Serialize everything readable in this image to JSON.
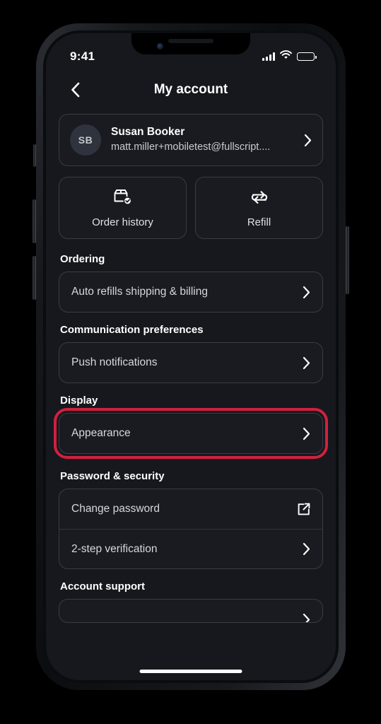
{
  "status_bar": {
    "time": "9:41",
    "signal_icon": "cellular-bars-icon",
    "wifi_icon": "wifi-icon",
    "battery_icon": "battery-full-icon"
  },
  "nav": {
    "back_icon": "chevron-left-icon",
    "title": "My account"
  },
  "profile": {
    "initials": "SB",
    "name": "Susan Booker",
    "email": "matt.miller+mobiletest@fullscript....",
    "chevron_icon": "chevron-right-icon"
  },
  "quick_actions": [
    {
      "label": "Order history",
      "icon": "package-check-icon"
    },
    {
      "label": "Refill",
      "icon": "repeat-arrows-icon"
    }
  ],
  "sections": [
    {
      "title": "Ordering",
      "highlighted": false,
      "rows": [
        {
          "label": "Auto refills shipping & billing",
          "accessory_icon": "chevron-right-icon"
        }
      ]
    },
    {
      "title": "Communication preferences",
      "highlighted": false,
      "rows": [
        {
          "label": "Push notifications",
          "accessory_icon": "chevron-right-icon"
        }
      ]
    },
    {
      "title": "Display",
      "highlighted": true,
      "rows": [
        {
          "label": "Appearance",
          "accessory_icon": "chevron-right-icon"
        }
      ]
    },
    {
      "title": "Password & security",
      "highlighted": false,
      "rows": [
        {
          "label": "Change password",
          "accessory_icon": "external-link-icon"
        },
        {
          "label": "2-step verification",
          "accessory_icon": "chevron-right-icon"
        }
      ]
    }
  ],
  "support_section": {
    "title": "Account support"
  },
  "colors": {
    "screen_background": "#16181d",
    "card_background": "#191b20",
    "card_border": "#393c44",
    "primary_text": "#ffffff",
    "secondary_text": "#d5d8dd",
    "highlight_ring": "#d1203f"
  },
  "home_indicator": "home-indicator"
}
